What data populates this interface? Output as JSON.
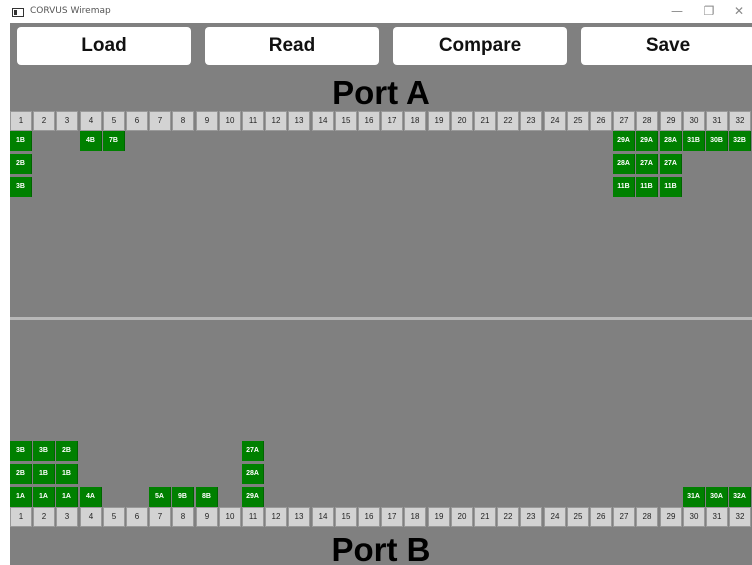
{
  "window": {
    "title": "CORVUS Wiremap",
    "minimize": "—",
    "restore": "❐",
    "close": "✕"
  },
  "toolbar": {
    "load_label": "Load",
    "read_label": "Read",
    "compare_label": "Compare",
    "save_label": "Save"
  },
  "portA": {
    "title": "Port A"
  },
  "portB": {
    "title": "Port B"
  },
  "columns": [
    "1",
    "2",
    "3",
    "4",
    "5",
    "6",
    "7",
    "8",
    "9",
    "10",
    "11",
    "12",
    "13",
    "14",
    "15",
    "16",
    "17",
    "18",
    "19",
    "20",
    "21",
    "22",
    "23",
    "24",
    "25",
    "26",
    "27",
    "28",
    "29",
    "30",
    "31",
    "32"
  ],
  "portA_cells": [
    {
      "col": 1,
      "row": 0,
      "label": "1B"
    },
    {
      "col": 4,
      "row": 0,
      "label": "4B"
    },
    {
      "col": 5,
      "row": 0,
      "label": "7B"
    },
    {
      "col": 27,
      "row": 0,
      "label": "29A"
    },
    {
      "col": 28,
      "row": 0,
      "label": "29A"
    },
    {
      "col": 29,
      "row": 0,
      "label": "28A"
    },
    {
      "col": 30,
      "row": 0,
      "label": "31B"
    },
    {
      "col": 31,
      "row": 0,
      "label": "30B"
    },
    {
      "col": 32,
      "row": 0,
      "label": "32B"
    },
    {
      "col": 1,
      "row": 1,
      "label": "2B"
    },
    {
      "col": 27,
      "row": 1,
      "label": "28A"
    },
    {
      "col": 28,
      "row": 1,
      "label": "27A"
    },
    {
      "col": 29,
      "row": 1,
      "label": "27A"
    },
    {
      "col": 1,
      "row": 2,
      "label": "3B"
    },
    {
      "col": 27,
      "row": 2,
      "label": "11B"
    },
    {
      "col": 28,
      "row": 2,
      "label": "11B"
    },
    {
      "col": 29,
      "row": 2,
      "label": "11B"
    }
  ],
  "portB_cells": [
    {
      "col": 1,
      "row": 0,
      "label": "1A"
    },
    {
      "col": 2,
      "row": 0,
      "label": "1A"
    },
    {
      "col": 3,
      "row": 0,
      "label": "1A"
    },
    {
      "col": 4,
      "row": 0,
      "label": "4A"
    },
    {
      "col": 7,
      "row": 0,
      "label": "5A"
    },
    {
      "col": 8,
      "row": 0,
      "label": "9B"
    },
    {
      "col": 9,
      "row": 0,
      "label": "8B"
    },
    {
      "col": 11,
      "row": 0,
      "label": "29A"
    },
    {
      "col": 30,
      "row": 0,
      "label": "31A"
    },
    {
      "col": 31,
      "row": 0,
      "label": "30A"
    },
    {
      "col": 32,
      "row": 0,
      "label": "32A"
    },
    {
      "col": 1,
      "row": 1,
      "label": "2B"
    },
    {
      "col": 2,
      "row": 1,
      "label": "1B"
    },
    {
      "col": 3,
      "row": 1,
      "label": "1B"
    },
    {
      "col": 11,
      "row": 1,
      "label": "28A"
    },
    {
      "col": 1,
      "row": 2,
      "label": "3B"
    },
    {
      "col": 2,
      "row": 2,
      "label": "3B"
    },
    {
      "col": 3,
      "row": 2,
      "label": "2B"
    },
    {
      "col": 11,
      "row": 2,
      "label": "27A"
    }
  ],
  "colors": {
    "background": "#808080",
    "cell_active": "#008000",
    "header_cell": "#d3d3d3",
    "button": "#ffffff"
  }
}
